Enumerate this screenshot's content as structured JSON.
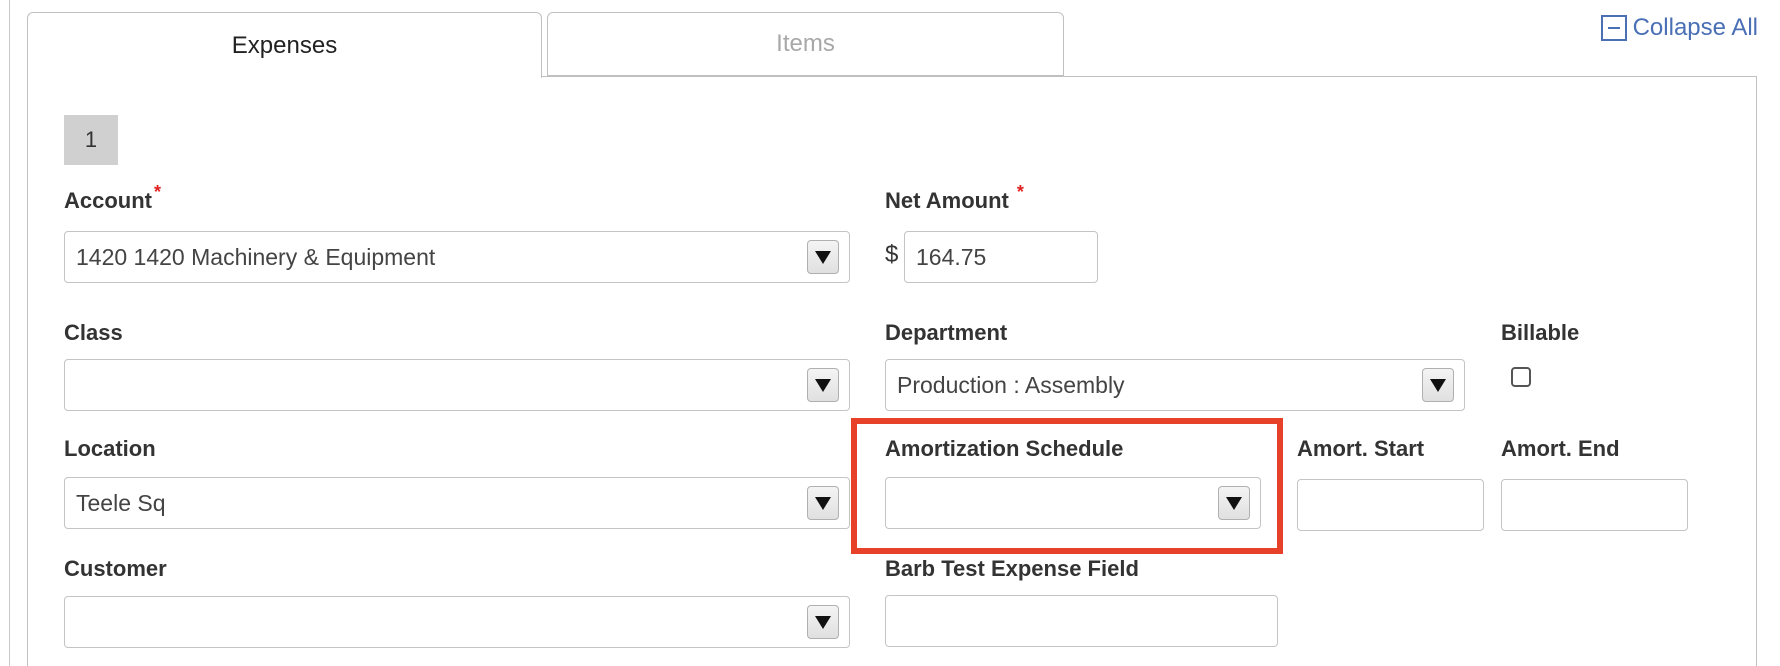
{
  "tabs": [
    {
      "label": "Expenses",
      "active": true
    },
    {
      "label": "Items",
      "active": false
    }
  ],
  "collapse_all": {
    "label": "Collapse All",
    "icon": "minus-square-icon"
  },
  "line_number": "1",
  "fields": {
    "account": {
      "label": "Account",
      "required": "*",
      "value": "1420 1420 Machinery & Equipment"
    },
    "net_amount": {
      "label": "Net Amount",
      "required": "*",
      "currency": "$",
      "value": "164.75"
    },
    "class": {
      "label": "Class",
      "value": ""
    },
    "department": {
      "label": "Department",
      "value": "Production : Assembly"
    },
    "billable": {
      "label": "Billable",
      "checked": false
    },
    "location": {
      "label": "Location",
      "value": "Teele Sq"
    },
    "amortization_schedule": {
      "label": "Amortization Schedule",
      "value": ""
    },
    "amort_start": {
      "label": "Amort. Start",
      "value": ""
    },
    "amort_end": {
      "label": "Amort. End",
      "value": ""
    },
    "customer": {
      "label": "Customer",
      "value": ""
    },
    "barb_test": {
      "label": "Barb Test Expense Field",
      "value": ""
    }
  },
  "colors": {
    "highlight": "#e8412a",
    "link": "#4a6fb5",
    "required": "#e02020"
  }
}
